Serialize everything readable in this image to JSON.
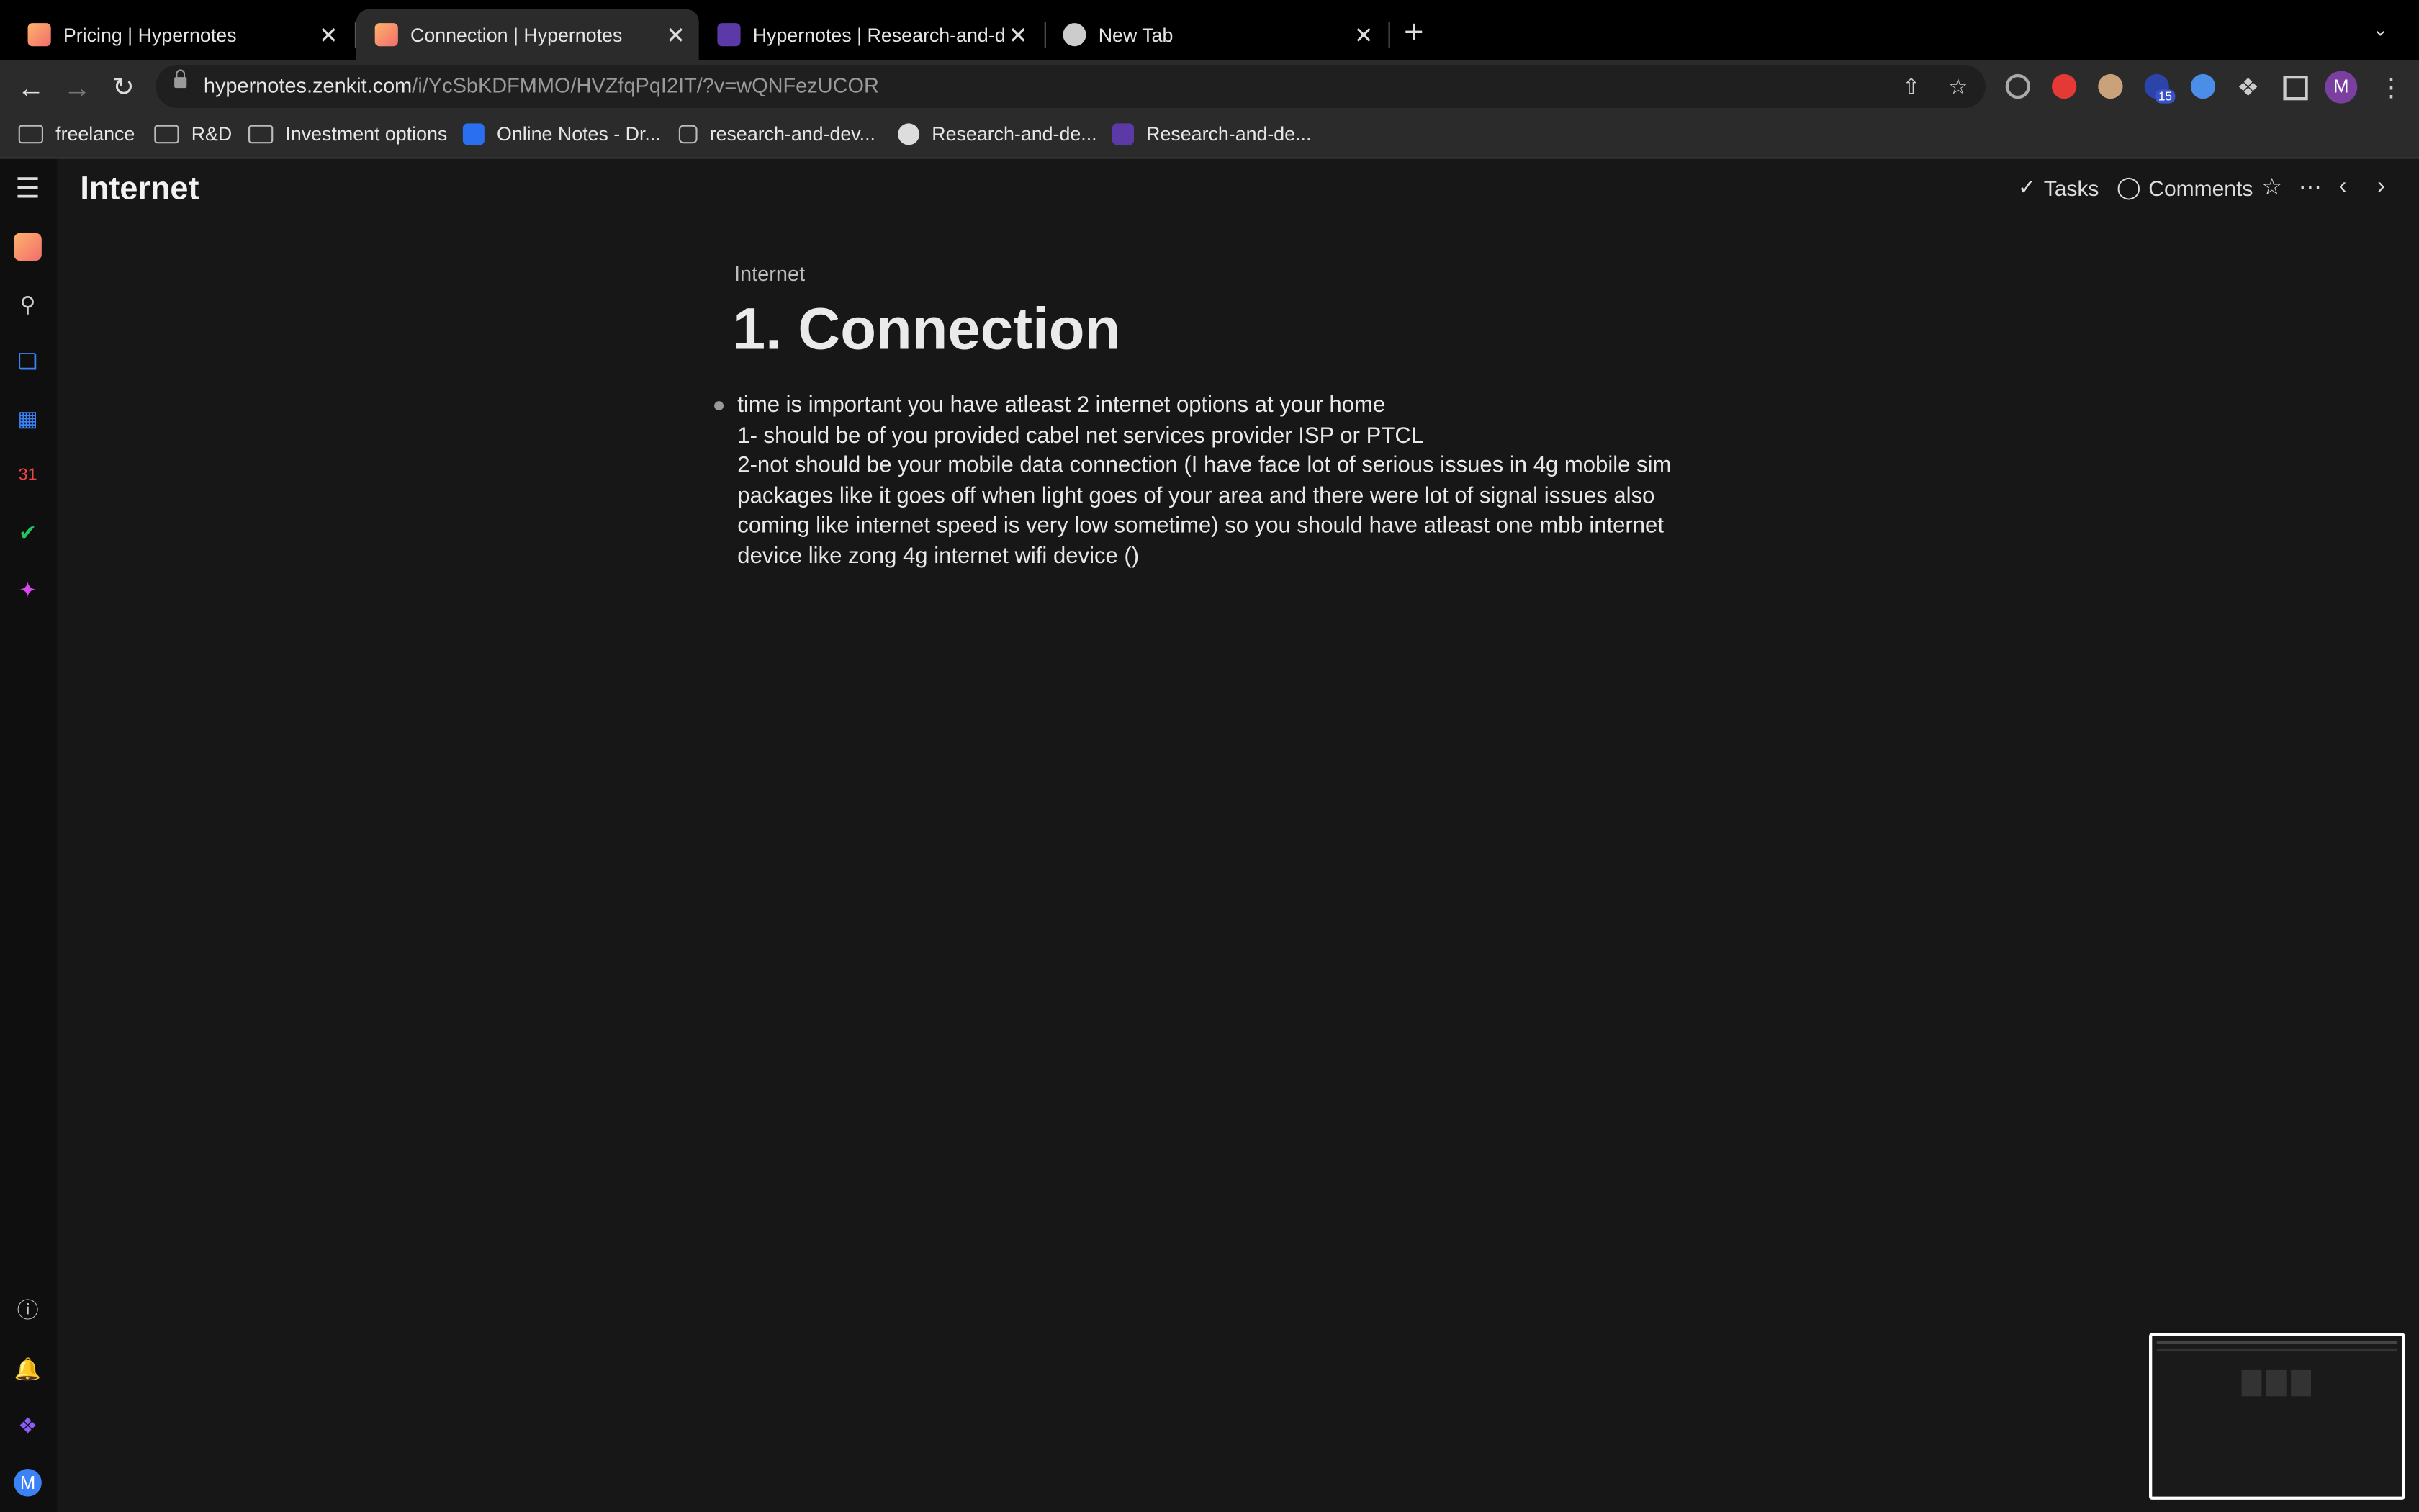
{
  "browser": {
    "tabs": [
      {
        "title": "Pricing | Hypernotes",
        "favicon": "hypernotes-icon"
      },
      {
        "title": "Connection | Hypernotes",
        "favicon": "hypernotes-icon",
        "active": true
      },
      {
        "title": "Hypernotes | Research-and-de",
        "favicon": "doc-icon"
      },
      {
        "title": "New Tab",
        "favicon": "chrome-icon"
      }
    ],
    "close_glyph": "✕",
    "new_tab_glyph": "+",
    "url_host": "hypernotes.zenkit.com",
    "url_path": "/i/YcSbKDFMMO/HVZfqPqI2IT/?v=wQNFezUCOR",
    "extension_badge": "15",
    "profile_initial": "M",
    "bookmarks": [
      {
        "label": "freelance",
        "icon": "folder-icon"
      },
      {
        "label": "R&D",
        "icon": "folder-icon"
      },
      {
        "label": "Investment options",
        "icon": "folder-icon"
      },
      {
        "label": "Online Notes - Dr...",
        "icon": "dropbox-icon"
      },
      {
        "label": "research-and-dev...",
        "icon": "page-icon"
      },
      {
        "label": "Research-and-de...",
        "icon": "globe-icon"
      },
      {
        "label": "Research-and-de...",
        "icon": "doc-icon"
      }
    ]
  },
  "app": {
    "header_title": "Internet",
    "tasks_label": "Tasks",
    "comments_label": "Comments",
    "profile_initial": "M"
  },
  "document": {
    "breadcrumb": "Internet",
    "title": "1. Connection",
    "lines": [
      "time is important you have atleast 2 internet options at your home",
      "1- should be of you provided cabel net services provider ISP or PTCL",
      "2-not should be your mobile data connection (I have face lot of serious issues in 4g mobile sim",
      "packages like it goes off when light goes of your area and there were lot of signal issues also",
      "coming like internet speed is very low sometime) so you should have atleast one mbb internet",
      "device like zong 4g internet wifi device ()"
    ]
  },
  "colors": {
    "accent_orange": "#f08a5d",
    "accent_blue": "#3b82f6",
    "accent_green": "#22c55e",
    "accent_red": "#ef4444",
    "accent_pink": "#d946ef",
    "profile_purple": "#7b3fa0"
  }
}
